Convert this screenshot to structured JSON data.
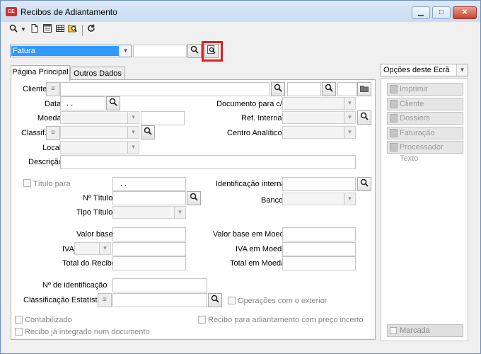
{
  "window": {
    "title": "Recibos de Adiantamento",
    "app_icon_text": "CE",
    "minimize": "▁",
    "maximize": "□",
    "close": "✕"
  },
  "topbar": {
    "doc_type_value": "Fatura"
  },
  "tabs": [
    {
      "label": "Página Principal"
    },
    {
      "label": "Outros Dados"
    }
  ],
  "form": {
    "cliente": "Cliente",
    "data": "Data",
    "data_value": ". .",
    "documento_para_cc": "Documento para c/c",
    "moeda": "Moeda",
    "ref_interna": "Ref. Interna",
    "classif": "Classif.",
    "centro_analitico": "Centro Analítico",
    "local": "Local",
    "descricao": "Descrição",
    "titulo_para": "Título para",
    "titulo_para_value": ". .",
    "identificacao_interna": "Identificação interna",
    "n_titulo": "Nº Título",
    "banco": "Banco",
    "tipo_titulo": "Tipo Título",
    "valor_base": "Valor base",
    "valor_base_moeda": "Valor base em Moeda",
    "iva": "IVA",
    "iva_moeda": "IVA em Moeda",
    "total_recibo": "Total do Recibo",
    "total_moeda": "Total em Moeda",
    "n_identificacao": "Nº de identificação",
    "classificacao_estatistica": "Classificação Estatística",
    "operacoes_exterior": "Operações com o exterior",
    "contabilizado": "Contabilizado",
    "recibo_preco_incerto": "Recibo para adiantamento com preço incerto",
    "recibo_integrado": "Recibo já integrado num documento"
  },
  "side": {
    "options_label": "Opções deste Ecrã",
    "buttons": [
      {
        "label": "Imprimir"
      },
      {
        "label": "Cliente"
      },
      {
        "label": "Dossiers"
      },
      {
        "label": "Faturação"
      },
      {
        "label": "Processador Texto"
      }
    ],
    "marcada": "Marcada"
  }
}
